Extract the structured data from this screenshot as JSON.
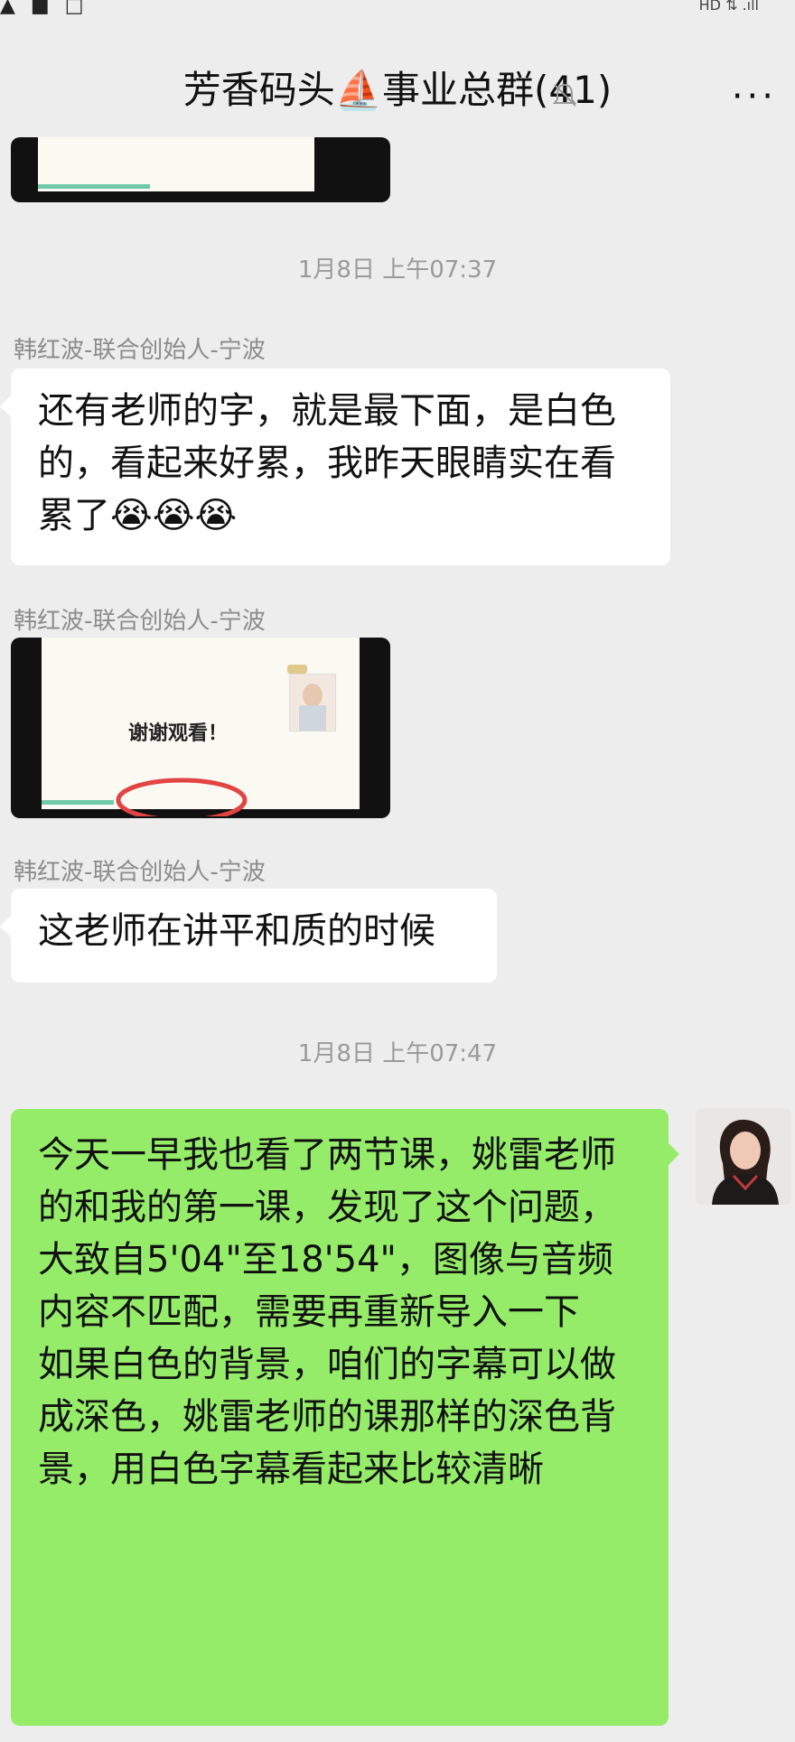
{
  "status_bar": {
    "left_icons": [
      "warning-icon",
      "app-icon",
      "doc-icon"
    ],
    "right_text": "HD ⇅ .ıll"
  },
  "header": {
    "title": "芳香码头⛵事业总群(41)",
    "mute_icon": "bell-off-icon",
    "more_label": "···"
  },
  "messages": [
    {
      "type": "timestamp",
      "text": "1月8日 上午07:37"
    },
    {
      "type": "text",
      "sender": "韩红波-联合创始人-宁波",
      "text": "还有老师的字，就是最下面，是白色的，看起来好累，我昨天眼睛实在看累了😭😭😭"
    },
    {
      "type": "image",
      "sender": "韩红波-联合创始人-宁波",
      "caption": "谢谢观看！"
    },
    {
      "type": "text",
      "sender": "韩红波-联合创始人-宁波",
      "text": "这老师在讲平和质的时候"
    },
    {
      "type": "timestamp",
      "text": "1月8日 上午07:47"
    },
    {
      "type": "text",
      "self": true,
      "text": "今天一早我也看了两节课，姚雷老师的和我的第一课，发现了这个问题，大致自5'04\"至18'54\"，图像与音频内容不匹配，需要再重新导入一下\n如果白色的背景，咱们的字幕可以做成深色，姚雷老师的课那样的深色背景，用白色字幕看起来比较清晰"
    }
  ]
}
